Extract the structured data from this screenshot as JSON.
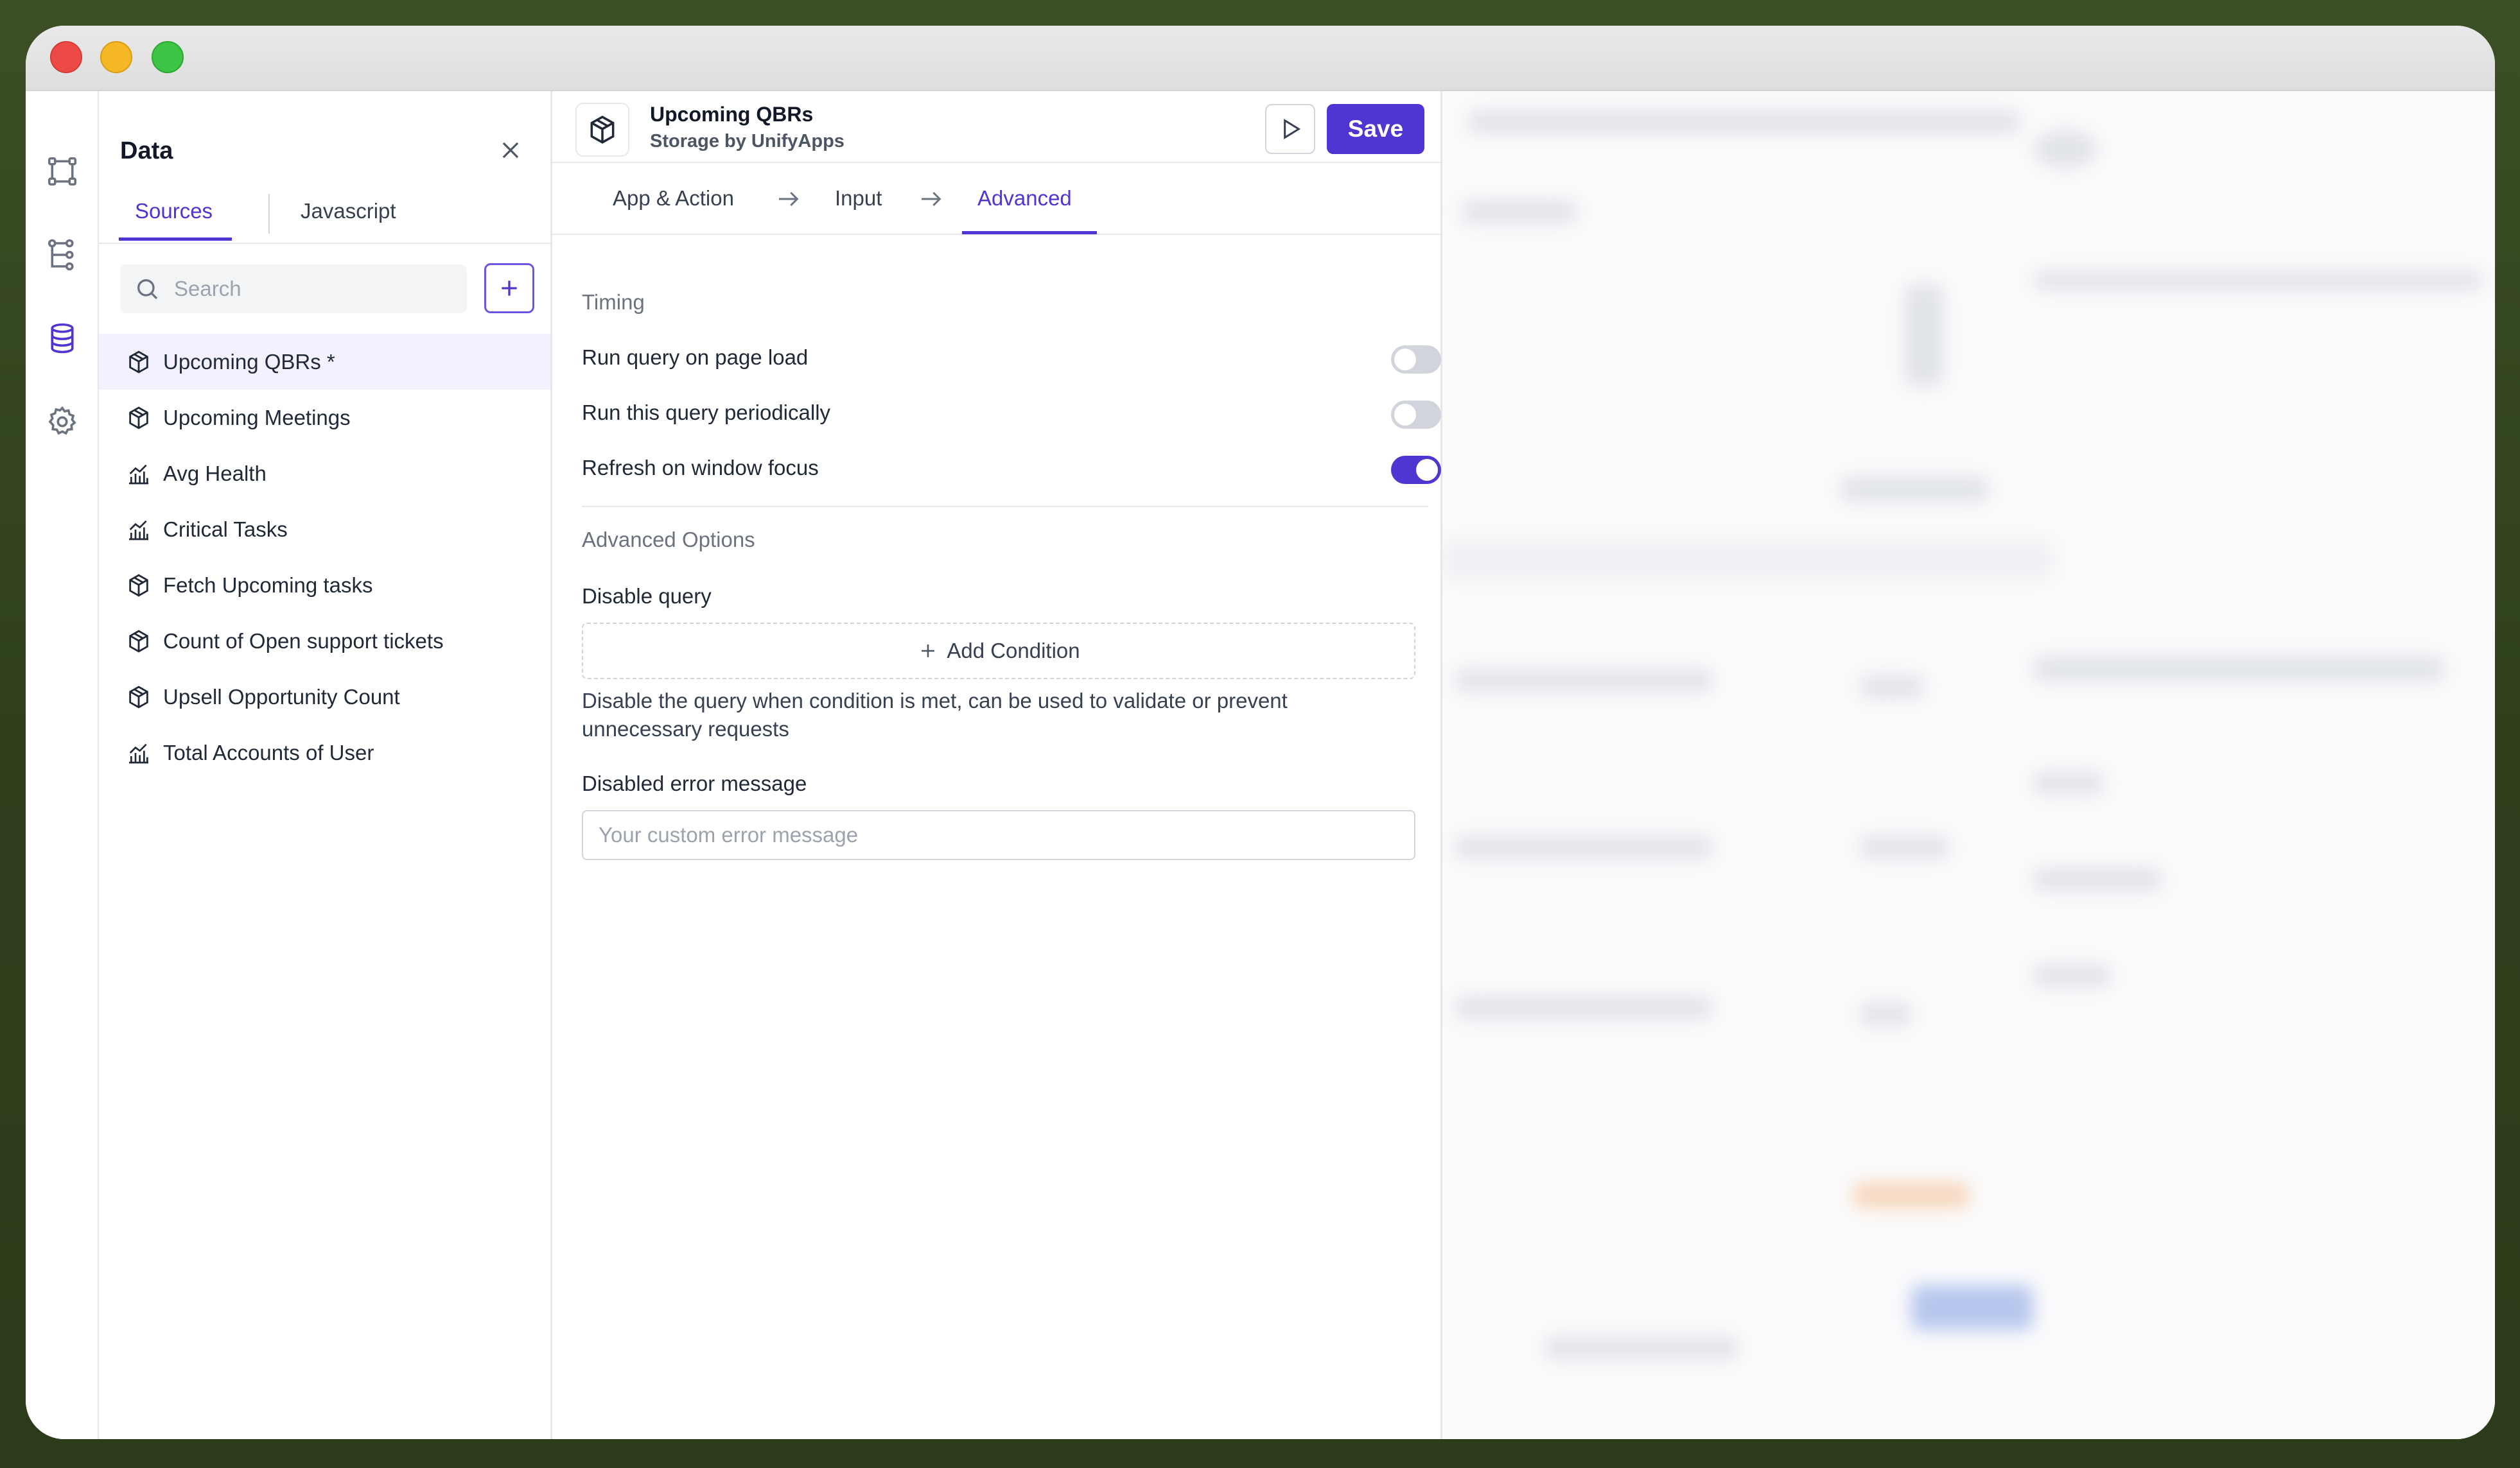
{
  "data_panel": {
    "title": "Data",
    "tabs": [
      {
        "label": "Sources",
        "active": true
      },
      {
        "label": "Javascript",
        "active": false
      }
    ],
    "search_placeholder": "Search",
    "items": [
      {
        "label": "Upcoming QBRs *",
        "icon": "cube-icon",
        "selected": true
      },
      {
        "label": "Upcoming Meetings",
        "icon": "cube-icon",
        "selected": false
      },
      {
        "label": "Avg Health",
        "icon": "bar-chart-icon",
        "selected": false
      },
      {
        "label": "Critical Tasks",
        "icon": "bar-chart-icon",
        "selected": false
      },
      {
        "label": "Fetch Upcoming tasks",
        "icon": "cube-icon",
        "selected": false
      },
      {
        "label": "Count of Open support tickets",
        "icon": "cube-icon",
        "selected": false
      },
      {
        "label": "Upsell Opportunity Count",
        "icon": "cube-icon",
        "selected": false
      },
      {
        "label": "Total Accounts of User",
        "icon": "bar-chart-icon",
        "selected": false
      }
    ]
  },
  "editor": {
    "title": "Upcoming QBRs",
    "subtitle": "Storage by UnifyApps",
    "save_label": "Save",
    "steps": [
      "App & Action",
      "Input",
      "Advanced"
    ],
    "active_step": "Advanced",
    "timing": {
      "heading": "Timing",
      "options": [
        {
          "label": "Run query on page load",
          "enabled": false
        },
        {
          "label": "Run this query periodically",
          "enabled": false
        },
        {
          "label": "Refresh on window focus",
          "enabled": true
        }
      ]
    },
    "advanced": {
      "heading": "Advanced Options",
      "disable_query_label": "Disable query",
      "add_condition_label": "Add Condition",
      "help_text": "Disable the query when condition is met, can be used to validate or prevent unnecessary requests",
      "error_message_label": "Disabled error message",
      "error_message_placeholder": "Your custom error message"
    }
  },
  "colors": {
    "accent": "#4f35d2",
    "selected_bg": "#f3f1fd",
    "toggle_off": "#d1d5db"
  }
}
